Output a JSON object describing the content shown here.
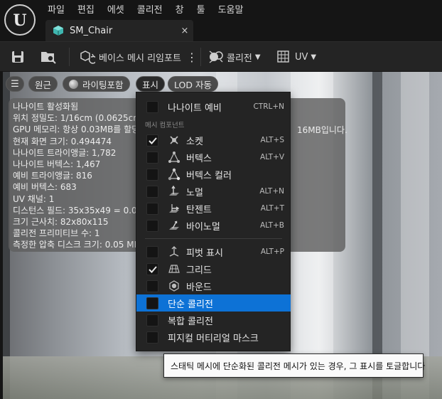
{
  "menubar": [
    "파일",
    "편집",
    "에셋",
    "콜리전",
    "창",
    "툴",
    "도움말"
  ],
  "tab": {
    "title": "SM_Chair",
    "close": "×"
  },
  "toolbar": {
    "reimport_label": "베이스 메시 리임포트",
    "collision_label": "콜리전",
    "uv_label": "UV"
  },
  "viewport_chips": {
    "perspective": "원근",
    "lighting": "라이팅포함",
    "show": "표시",
    "lod": "LOD 자동"
  },
  "stats": [
    "나나이트 활성화됨",
    "위치 정밀도: 1/16cm (0.0625cm)",
    "GPU 메모리: 항상 0.03MB를 할당",
    "현재 화면 크기: 0.494474",
    "나나이트 트라이앵글: 1,782",
    "나나이트 버텍스: 1,467",
    "예비 트라이앵글: 816",
    "예비 버텍스: 683",
    "UV 채널: 1",
    "디스턴스 필드: 35x35x49 = 0.00",
    "크기 근사치: 82x80x115",
    "콜리전 프리미티브 수: 1",
    "측정한 압축 디스크 크기: 0.05 MB"
  ],
  "stats_tail": "16MB입니다.",
  "show_menu": {
    "nanite_preview": {
      "label": "나나이트 예비",
      "shortcut": "CTRL+N",
      "checked": false
    },
    "section_label": "메시 컴포넌트",
    "items": [
      {
        "label": "소켓",
        "shortcut": "ALT+S",
        "checked": true,
        "icon": "socket-icon"
      },
      {
        "label": "버텍스",
        "shortcut": "ALT+V",
        "checked": false,
        "icon": "vertex-icon"
      },
      {
        "label": "버텍스 컬러",
        "shortcut": "",
        "checked": false,
        "icon": "vertex-color-icon"
      },
      {
        "label": "노멀",
        "shortcut": "ALT+N",
        "checked": false,
        "icon": "normal-icon"
      },
      {
        "label": "탄젠트",
        "shortcut": "ALT+T",
        "checked": false,
        "icon": "tangent-icon"
      },
      {
        "label": "바이노멀",
        "shortcut": "ALT+B",
        "checked": false,
        "icon": "binormal-icon"
      }
    ],
    "items2": [
      {
        "label": "피벗 표시",
        "shortcut": "ALT+P",
        "checked": false,
        "icon": "pivot-icon"
      },
      {
        "label": "그리드",
        "shortcut": "",
        "checked": true,
        "icon": "grid-icon"
      },
      {
        "label": "바운드",
        "shortcut": "",
        "checked": false,
        "icon": "bounds-icon"
      }
    ],
    "simple_collision": {
      "label": "단순 콜리전",
      "checked": false,
      "highlighted": true
    },
    "complex_collision": {
      "label": "복합 콜리전",
      "checked": false
    },
    "physical_material_mask": {
      "label": "피지컬 머티리얼 마스크",
      "checked": false
    }
  },
  "tooltip": "스태틱 메시에 단순화된 콜리전 메시가 있는 경우, 그 표시를 토글합니다",
  "colors": {
    "highlight": "#0d72d6",
    "menu_bg": "#242424",
    "toolbar_bg": "#242424",
    "accent_teal": "#3fb6b0"
  }
}
